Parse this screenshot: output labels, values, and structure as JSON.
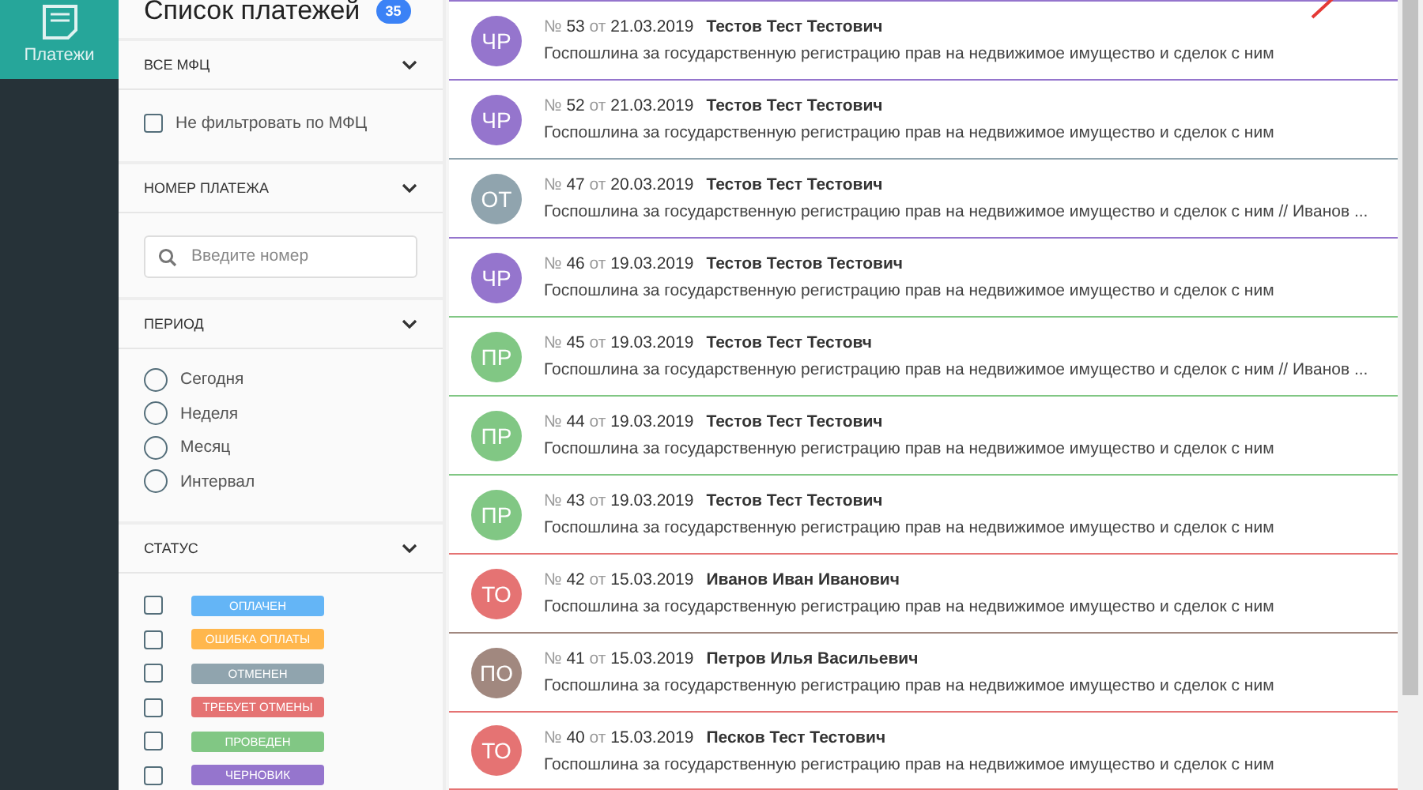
{
  "nav": {
    "items": [
      {
        "label": "Платежи",
        "selected": true
      }
    ]
  },
  "filters": {
    "title": "Список платежей",
    "count": "35",
    "sections": [
      {
        "kind": "checkboxes",
        "title": "ВСЕ МФЦ",
        "expanded": true,
        "options": [
          {
            "label": "Не фильтровать по МФЦ",
            "checked": false
          }
        ]
      },
      {
        "kind": "search",
        "title": "НОМЕР ПЛАТЕЖА",
        "expanded": true,
        "placeholder": "Введите номер"
      },
      {
        "kind": "radios",
        "title": "ПЕРИОД",
        "expanded": true,
        "options": [
          {
            "label": "Сегодня",
            "selected": false
          },
          {
            "label": "Неделя",
            "selected": false
          },
          {
            "label": "Месяц",
            "selected": false
          },
          {
            "label": "Интервал",
            "selected": false
          }
        ]
      },
      {
        "kind": "statuses",
        "title": "СТАТУС",
        "expanded": true,
        "options": [
          {
            "label": "ОПЛАЧЕН",
            "checked": false,
            "color": "#64b5f6"
          },
          {
            "label": "ОШИБКА ОПЛАТЫ",
            "checked": false,
            "color": "#ffb74d"
          },
          {
            "label": "ОТМЕНЕН",
            "checked": false,
            "color": "#90a4ae"
          },
          {
            "label": "ТРЕБУЕТ ОТМЕНЫ",
            "checked": false,
            "color": "#e57373"
          },
          {
            "label": "ПРОВЕДЕН",
            "checked": false,
            "color": "#81c784"
          },
          {
            "label": "ЧЕРНОВИК",
            "checked": false,
            "color": "#9575cd"
          }
        ]
      }
    ]
  },
  "payments": [
    {
      "initials": "ЧР",
      "color": "#9575cd",
      "number_label": "№",
      "number": "53",
      "date_label": "от",
      "date": "21.03.2019",
      "payer": "Тестов Тест Тестович",
      "description": "Госпошлина за государственную регистрацию прав на недвижимое имущество и сделок с ним"
    },
    {
      "initials": "ЧР",
      "color": "#9575cd",
      "number_label": "№",
      "number": "52",
      "date_label": "от",
      "date": "21.03.2019",
      "payer": "Тестов Тест Тестович",
      "description": "Госпошлина за государственную регистрацию прав на недвижимое имущество и сделок с ним"
    },
    {
      "initials": "ОТ",
      "color": "#90a4ae",
      "number_label": "№",
      "number": "47",
      "date_label": "от",
      "date": "20.03.2019",
      "payer": "Тестов Тест Тестович",
      "description": "Госпошлина за государственную регистрацию прав на недвижимое имущество и сделок с ним // Иванов ..."
    },
    {
      "initials": "ЧР",
      "color": "#9575cd",
      "number_label": "№",
      "number": "46",
      "date_label": "от",
      "date": "19.03.2019",
      "payer": "Тестов Тестов Тестович",
      "description": "Госпошлина за государственную регистрацию прав на недвижимое имущество и сделок с ним"
    },
    {
      "initials": "ПР",
      "color": "#81c784",
      "number_label": "№",
      "number": "45",
      "date_label": "от",
      "date": "19.03.2019",
      "payer": "Тестов Тест Тестовч",
      "description": "Госпошлина за государственную регистрацию прав на недвижимое имущество и сделок с ним // Иванов ..."
    },
    {
      "initials": "ПР",
      "color": "#81c784",
      "number_label": "№",
      "number": "44",
      "date_label": "от",
      "date": "19.03.2019",
      "payer": "Тестов Тест Тестович",
      "description": "Госпошлина за государственную регистрацию прав на недвижимое имущество и сделок с ним"
    },
    {
      "initials": "ПР",
      "color": "#81c784",
      "number_label": "№",
      "number": "43",
      "date_label": "от",
      "date": "19.03.2019",
      "payer": "Тестов Тест Тестович",
      "description": "Госпошлина за государственную регистрацию прав на недвижимое имущество и сделок с ним"
    },
    {
      "initials": "ТО",
      "color": "#e57373",
      "number_label": "№",
      "number": "42",
      "date_label": "от",
      "date": "15.03.2019",
      "payer": "Иванов Иван Иванович",
      "description": "Госпошлина за государственную регистрацию прав на недвижимое имущество и сделок с ним"
    },
    {
      "initials": "ПО",
      "color": "#a1887f",
      "number_label": "№",
      "number": "41",
      "date_label": "от",
      "date": "15.03.2019",
      "payer": "Петров Илья Васильевич",
      "description": "Госпошлина за государственную регистрацию прав на недвижимое имущество и сделок с ним"
    },
    {
      "initials": "ТО",
      "color": "#e57373",
      "number_label": "№",
      "number": "40",
      "date_label": "от",
      "date": "15.03.2019",
      "payer": "Песков Тест Тестович",
      "description": "Госпошлина за государственную регистрацию прав на недвижимое имущество и сделок с ним"
    }
  ]
}
